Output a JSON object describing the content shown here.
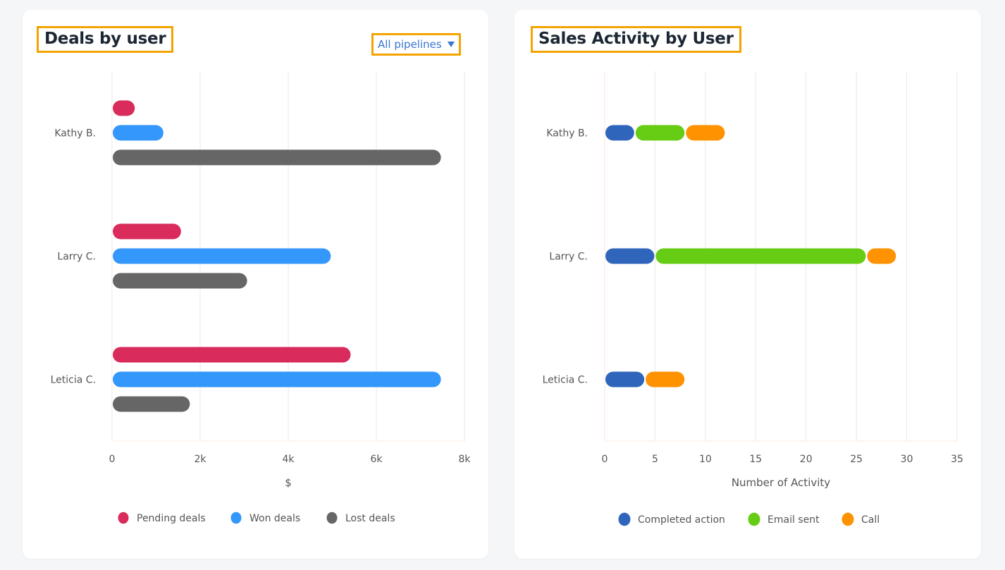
{
  "left_card": {
    "title": "Deals by user",
    "pipeline_dropdown": {
      "selected": "All pipelines"
    }
  },
  "right_card": {
    "title": "Sales Activity by User"
  },
  "chart_data": [
    {
      "type": "bar",
      "orientation": "horizontal",
      "grouping": "grouped",
      "title": "Deals by user",
      "categories": [
        "Kathy B.",
        "Larry C.",
        "Leticia C."
      ],
      "series": [
        {
          "name": "Pending deals",
          "color": "#d92b5c",
          "values": [
            500,
            1550,
            5400
          ]
        },
        {
          "name": "Won deals",
          "color": "#3397fc",
          "values": [
            1150,
            4950,
            7450
          ]
        },
        {
          "name": "Lost deals",
          "color": "#666666",
          "values": [
            7450,
            3050,
            1750
          ]
        }
      ],
      "xlabel": "$",
      "ylabel": "",
      "xlim": [
        0,
        8000
      ],
      "xticks": [
        0,
        2000,
        4000,
        6000,
        8000
      ],
      "xtick_labels": [
        "0",
        "2k",
        "4k",
        "6k",
        "8k"
      ],
      "grid": true,
      "legend_position": "bottom"
    },
    {
      "type": "bar",
      "orientation": "horizontal",
      "grouping": "stacked",
      "title": "Sales Activity by User",
      "categories": [
        "Kathy B.",
        "Larry C.",
        "Leticia C."
      ],
      "series": [
        {
          "name": "Completed action",
          "color": "#2f66bb",
          "values": [
            3,
            5,
            4
          ]
        },
        {
          "name": "Email sent",
          "color": "#66cc14",
          "values": [
            5,
            21,
            0
          ]
        },
        {
          "name": "Call",
          "color": "#ff9200",
          "values": [
            4,
            3,
            4
          ]
        }
      ],
      "xlabel": "Number of Activity",
      "ylabel": "",
      "xlim": [
        0,
        35
      ],
      "xticks": [
        0,
        5,
        10,
        15,
        20,
        25,
        30,
        35
      ],
      "xtick_labels": [
        "0",
        "5",
        "10",
        "15",
        "20",
        "25",
        "30",
        "35"
      ],
      "grid": true,
      "legend_position": "bottom"
    }
  ]
}
